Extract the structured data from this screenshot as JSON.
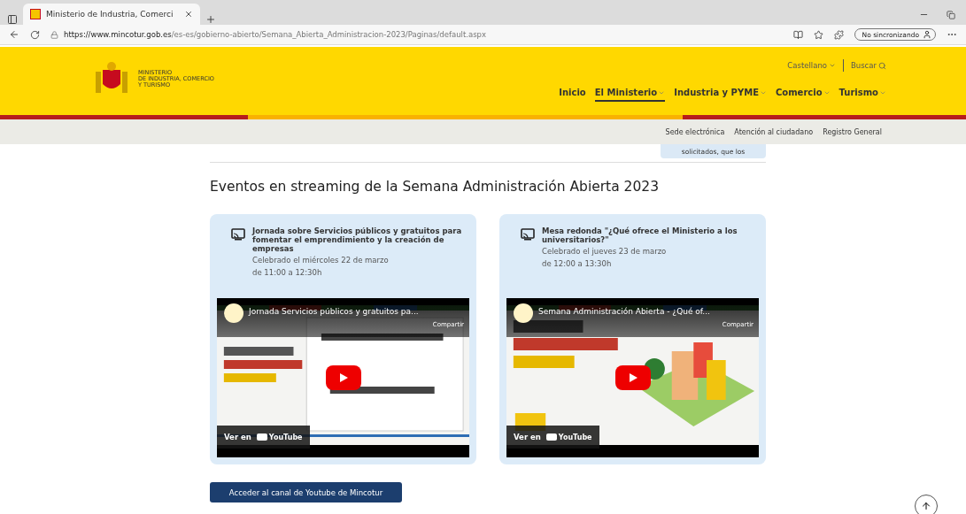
{
  "browser": {
    "tab_title": "Ministerio de Industria, Comerci",
    "url_host": "https://www.mincotur.gob.es",
    "url_path": "/es-es/gobierno-abierto/Semana_Abierta_Administracion-2023/Paginas/default.aspx",
    "sync_label": "No sincronizando"
  },
  "header": {
    "logo_lines": [
      "MINISTERIO",
      "DE INDUSTRIA, COMERCIO",
      "Y TURISMO"
    ],
    "language": "Castellano",
    "search": "Buscar",
    "nav": [
      {
        "label": "Inicio",
        "selected": false,
        "has_menu": false
      },
      {
        "label": "El Ministerio",
        "selected": true,
        "has_menu": true
      },
      {
        "label": "Industria y PYME",
        "selected": false,
        "has_menu": true
      },
      {
        "label": "Comercio",
        "selected": false,
        "has_menu": true
      },
      {
        "label": "Turismo",
        "selected": false,
        "has_menu": true
      }
    ]
  },
  "utility_links": [
    "Sede electrónica",
    "Atención al ciudadano",
    "Registro General"
  ],
  "partial_text": "solicitados, que los",
  "heading": "Eventos en streaming de la Semana Administración Abierta 2023",
  "events": [
    {
      "title": "Jornada sobre Servicios públicos y gratuitos para fomentar el emprendimiento y la creación de empresas",
      "date": "Celebrado el miércoles 22 de marzo",
      "time": "de 11:00 a 12:30h",
      "video": {
        "title": "Jornada Servicios públicos y gratuitos pa...",
        "share": "Compartir",
        "watch": "Ver en",
        "brand": "YouTube"
      }
    },
    {
      "title": "Mesa redonda \"¿Qué ofrece el Ministerio a los universitarios?\"",
      "date": "Celebrado el jueves 23 de marzo",
      "time": "de 12:00 a 13:30h",
      "video": {
        "title": "Semana Administración Abierta - ¿Qué of...",
        "share": "Compartir",
        "watch": "Ver en",
        "brand": "YouTube"
      }
    }
  ],
  "channel_button": "Acceder al canal de Youtube de Mincotur"
}
